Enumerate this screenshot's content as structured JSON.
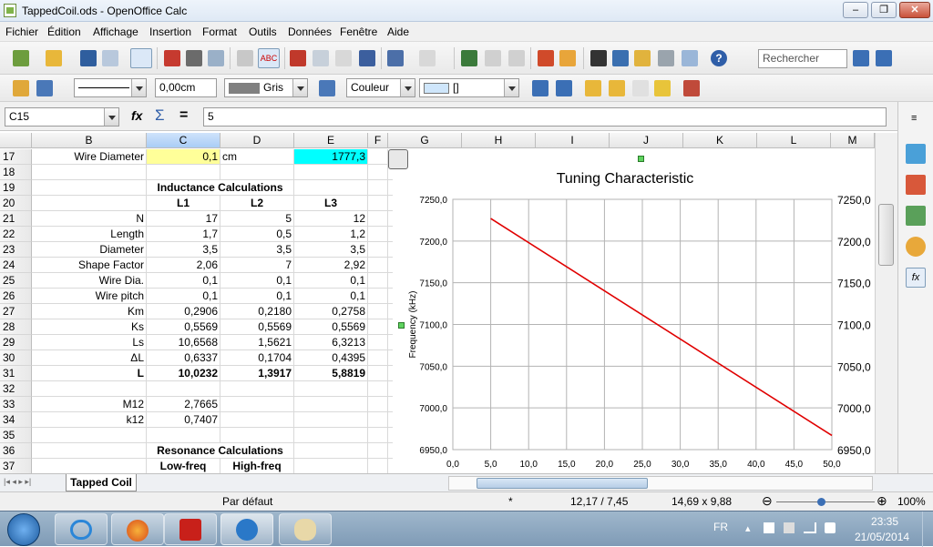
{
  "window": {
    "title": "TappedCoil.ods - OpenOffice Calc",
    "min": "–",
    "max": "❐",
    "close": "✕"
  },
  "menu": [
    "Fichier",
    "Édition",
    "Affichage",
    "Insertion",
    "Format",
    "Outils",
    "Données",
    "Fenêtre",
    "Aide"
  ],
  "toolbar1": {
    "search_placeholder": "Rechercher"
  },
  "toolbar2": {
    "line_width": "0,00cm",
    "line_color": "Gris",
    "area_style": "Couleur",
    "area_value": "[]"
  },
  "formula": {
    "name_box": "C15",
    "fx": "fx",
    "sigma": "Σ",
    "equals": "=",
    "content": "5"
  },
  "columns": [
    "B",
    "C",
    "D",
    "E",
    "F",
    "G",
    "H",
    "I",
    "J",
    "K",
    "L",
    "M"
  ],
  "rows": [
    {
      "n": "17",
      "b": "Wire Diameter",
      "c": "0,1",
      "d": "cm",
      "e": "1777,3"
    },
    {
      "n": "18"
    },
    {
      "n": "19",
      "title": "Inductance Calculations"
    },
    {
      "n": "20",
      "c": "L1",
      "d": "L2",
      "e": "L3",
      "hdr": true
    },
    {
      "n": "21",
      "b": "N",
      "c": "17",
      "d": "5",
      "e": "12"
    },
    {
      "n": "22",
      "b": "Length",
      "c": "1,7",
      "d": "0,5",
      "e": "1,2"
    },
    {
      "n": "23",
      "b": "Diameter",
      "c": "3,5",
      "d": "3,5",
      "e": "3,5"
    },
    {
      "n": "24",
      "b": "Shape Factor",
      "c": "2,06",
      "d": "7",
      "e": "2,92"
    },
    {
      "n": "25",
      "b": "Wire Dia.",
      "c": "0,1",
      "d": "0,1",
      "e": "0,1"
    },
    {
      "n": "26",
      "b": "Wire pitch",
      "c": "0,1",
      "d": "0,1",
      "e": "0,1"
    },
    {
      "n": "27",
      "b": "Km",
      "c": "0,2906",
      "d": "0,2180",
      "e": "0,2758"
    },
    {
      "n": "28",
      "b": "Ks",
      "c": "0,5569",
      "d": "0,5569",
      "e": "0,5569"
    },
    {
      "n": "29",
      "b": "Ls",
      "c": "10,6568",
      "d": "1,5621",
      "e": "6,3213"
    },
    {
      "n": "30",
      "b": "ΔL",
      "c": "0,6337",
      "d": "0,1704",
      "e": "0,4395"
    },
    {
      "n": "31",
      "b": "L",
      "c": "10,0232",
      "d": "1,3917",
      "e": "5,8819",
      "bold": true
    },
    {
      "n": "32"
    },
    {
      "n": "33",
      "b": "M12",
      "c": "2,7665"
    },
    {
      "n": "34",
      "b": "k12",
      "c": "0,7407"
    },
    {
      "n": "35"
    },
    {
      "n": "36",
      "title": "Resonance Calculations"
    },
    {
      "n": "37",
      "c": "Low-freq",
      "d": "High-freq",
      "hdr": true
    }
  ],
  "chart_data": {
    "type": "line",
    "title": "Tuning Characteristic",
    "ylabel": "Frequency (kHz)",
    "xlabel": "",
    "xlim": [
      0,
      50
    ],
    "ylim": [
      6950,
      7250
    ],
    "x_ticks": [
      "0,0",
      "5,0",
      "10,0",
      "15,0",
      "20,0",
      "25,0",
      "30,0",
      "35,0",
      "40,0",
      "45,0",
      "50,0"
    ],
    "y_ticks": [
      "6950,0",
      "7000,0",
      "7050,0",
      "7100,0",
      "7150,0",
      "7200,0",
      "7250,0"
    ],
    "grid": true,
    "series": [
      {
        "color": "#e00000",
        "x": [
          5,
          50
        ],
        "y": [
          7227,
          6967
        ]
      }
    ]
  },
  "sheet_tab": "Tapped Coil",
  "status": {
    "page_style": "Par défaut",
    "mode": "*",
    "position": "12,17 / 7,45",
    "size": "14,69 x 9,88",
    "zoom": "100%"
  },
  "taskbar": {
    "lang": "FR",
    "time": "23:35",
    "date": "21/05/2014"
  }
}
